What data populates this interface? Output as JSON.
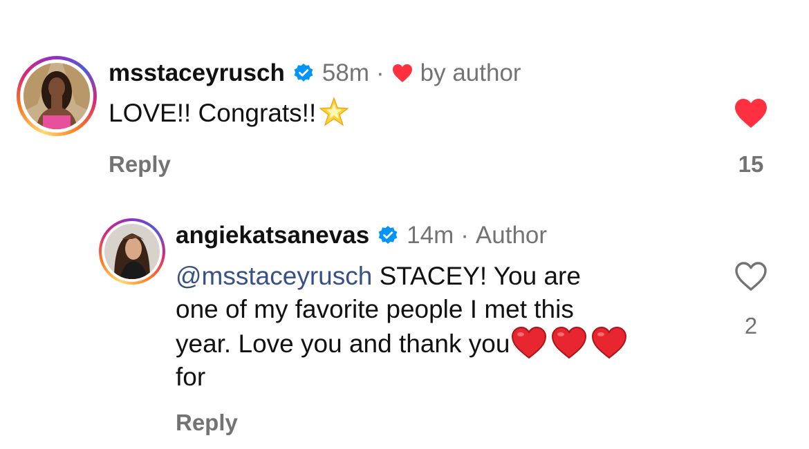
{
  "comments": [
    {
      "username": "msstaceyrusch",
      "verified": true,
      "time": "58m",
      "separator": "·",
      "liked_by_author_label": "by author",
      "text": "LOVE!! Congrats!!",
      "emoji": "star-emoji",
      "reply_label": "Reply",
      "liked": true,
      "like_count": "15"
    },
    {
      "username": "angiekatsanevas",
      "verified": true,
      "time": "14m",
      "separator": "·",
      "author_label": "Author",
      "mention": "@msstaceyrusch",
      "text_line1": " STACEY! You are",
      "text_line2": "one of my favorite people I met this",
      "text_line3": "year. Love you and thank you",
      "text_line4": "for",
      "emoji": "red-heart-emoji",
      "reply_label": "Reply",
      "liked": false,
      "like_count": "2"
    }
  ],
  "colors": {
    "like_red": "#ff3040",
    "verified_blue": "#0095f6",
    "mention_blue": "#385185",
    "meta_gray": "#737373"
  }
}
